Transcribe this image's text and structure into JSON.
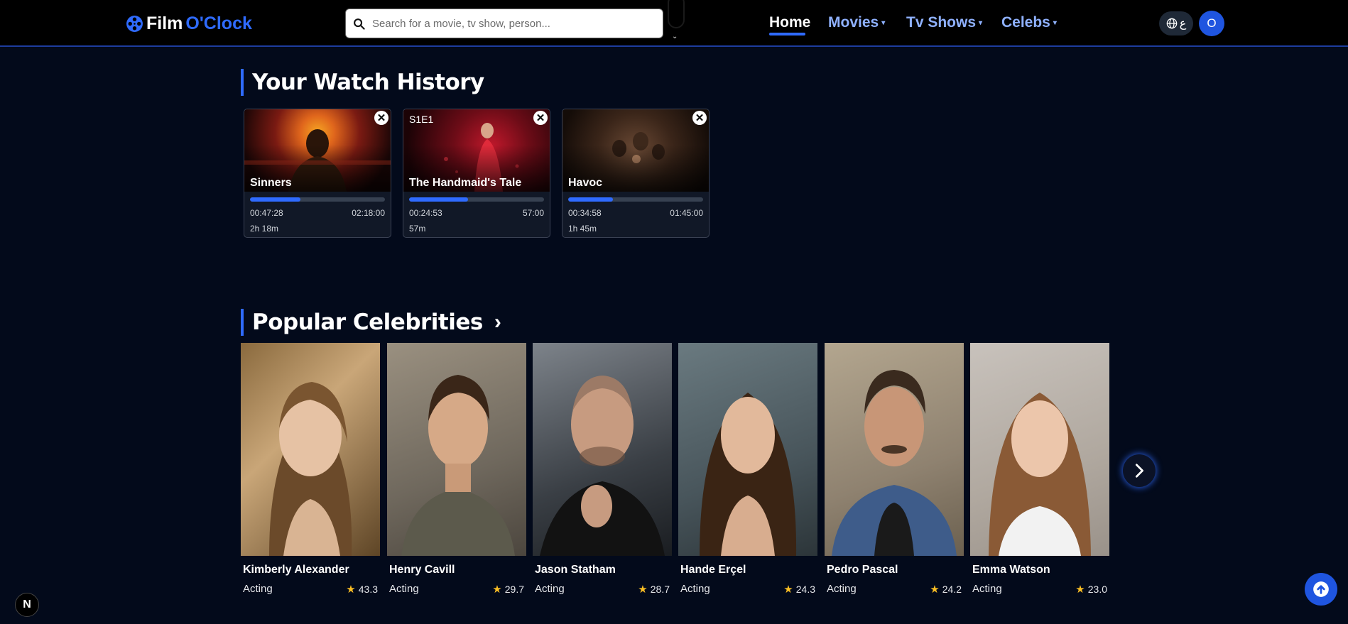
{
  "header": {
    "logo": {
      "part1": "Film",
      "part2": "O'Clock"
    },
    "search_placeholder": "Search for a movie, tv show, person...",
    "nav": [
      {
        "label": "Home",
        "active": true
      },
      {
        "label": "Movies",
        "dropdown": true
      },
      {
        "label": "Tv Shows",
        "dropdown": true
      },
      {
        "label": "Celebs",
        "dropdown": true
      }
    ],
    "language_label": "ع",
    "avatar_initial": "O"
  },
  "watch_history": {
    "title": "Your Watch History",
    "items": [
      {
        "title": "Sinners",
        "episode": "",
        "elapsed": "00:47:28",
        "total": "02:18:00",
        "progress": 0.344,
        "duration": "2h 18m"
      },
      {
        "title": "The Handmaid's Tale",
        "episode": "S1E1",
        "elapsed": "00:24:53",
        "total": "57:00",
        "progress": 0.437,
        "duration": "57m"
      },
      {
        "title": "Havoc",
        "episode": "",
        "elapsed": "00:34:58",
        "total": "01:45:00",
        "progress": 0.333,
        "duration": "1h 45m"
      }
    ]
  },
  "celebrities": {
    "title": "Popular Celebrities",
    "items": [
      {
        "name": "Kimberly Alexander",
        "department": "Acting",
        "rating": "43.3"
      },
      {
        "name": "Henry Cavill",
        "department": "Acting",
        "rating": "29.7"
      },
      {
        "name": "Jason Statham",
        "department": "Acting",
        "rating": "28.7"
      },
      {
        "name": "Hande Erçel",
        "department": "Acting",
        "rating": "24.3"
      },
      {
        "name": "Pedro Pascal",
        "department": "Acting",
        "rating": "24.2"
      },
      {
        "name": "Emma Watson",
        "department": "Acting",
        "rating": "23.0"
      }
    ]
  },
  "badge_letter": "N",
  "colors": {
    "accent": "#2f6bff",
    "background": "#030a1b",
    "header": "#000000",
    "star": "#fbbf24"
  }
}
